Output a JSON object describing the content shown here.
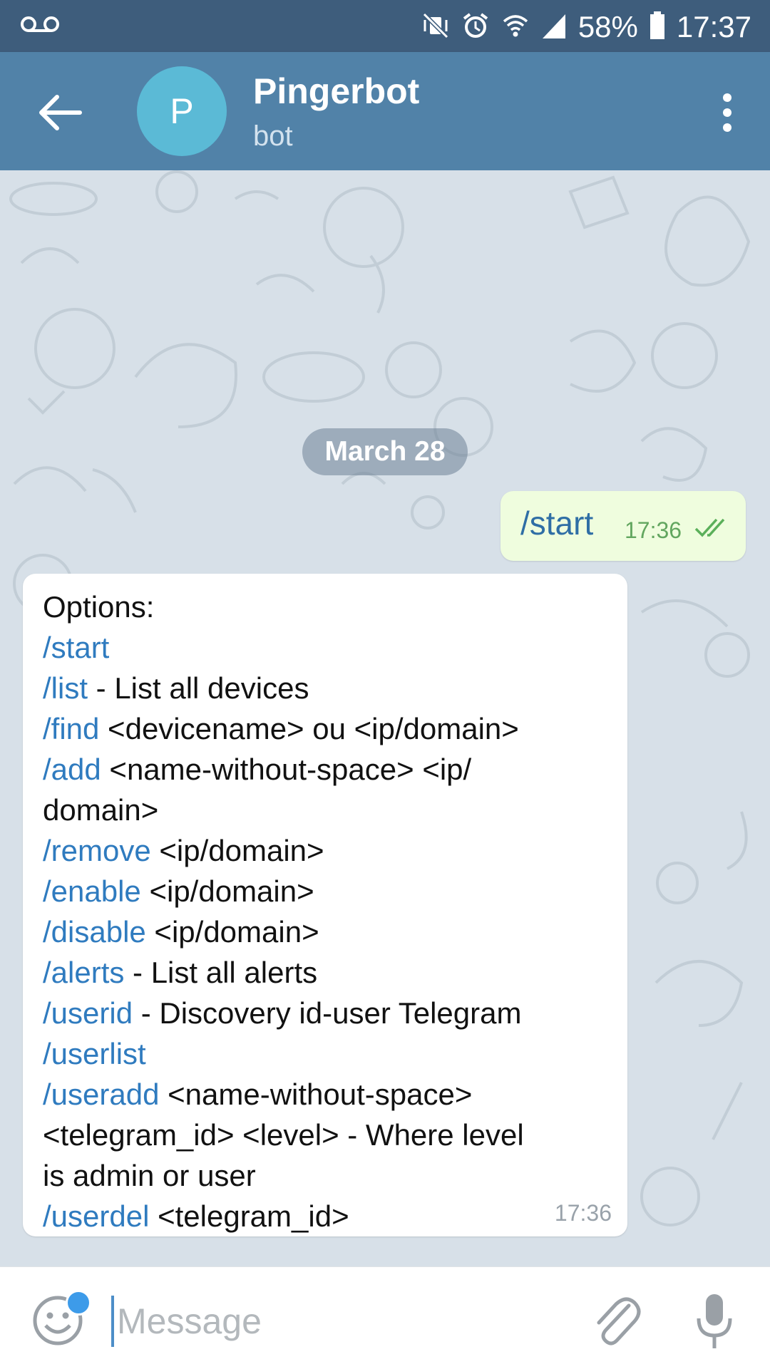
{
  "status_bar": {
    "battery": "58%",
    "time": "17:37",
    "icons": [
      "voicemail-icon",
      "mute-vibrate-icon",
      "alarm-icon",
      "wifi-icon",
      "signal-icon",
      "battery-icon"
    ]
  },
  "header": {
    "avatar_letter": "P",
    "title": "Pingerbot",
    "subtitle": "bot"
  },
  "chat": {
    "date": "March 28",
    "outgoing": {
      "text": "/start",
      "time": "17:36",
      "status": "read"
    },
    "incoming": {
      "time": "17:36",
      "lines": [
        {
          "cmd": "",
          "text": "Options:"
        },
        {
          "cmd": "/start",
          "text": ""
        },
        {
          "cmd": "/list",
          "text": " - List all devices"
        },
        {
          "cmd": "/find",
          "text": " <devicename> ou <ip/domain>"
        },
        {
          "cmd": "/add",
          "text": " <name-without-space> <ip/"
        },
        {
          "cmd": "",
          "text": "domain>"
        },
        {
          "cmd": "/remove",
          "text": " <ip/domain>"
        },
        {
          "cmd": "/enable",
          "text": " <ip/domain>"
        },
        {
          "cmd": "/disable",
          "text": " <ip/domain>"
        },
        {
          "cmd": "/alerts",
          "text": " - List all alerts"
        },
        {
          "cmd": "/userid",
          "text": " - Discovery id-user Telegram"
        },
        {
          "cmd": "/userlist",
          "text": ""
        },
        {
          "cmd": "/useradd",
          "text": " <name-without-space>"
        },
        {
          "cmd": "",
          "text": "<telegram_id> <level> - Where level"
        },
        {
          "cmd": "",
          "text": "is admin or user"
        },
        {
          "cmd": "/userdel",
          "text": " <telegram_id>"
        }
      ]
    }
  },
  "input": {
    "placeholder": "Message"
  },
  "colors": {
    "status_bar": "#3e5d7c",
    "header": "#5182a8",
    "avatar": "#5bbad6",
    "command_link": "#2f7bbf",
    "outgoing_bubble": "#effdde"
  }
}
